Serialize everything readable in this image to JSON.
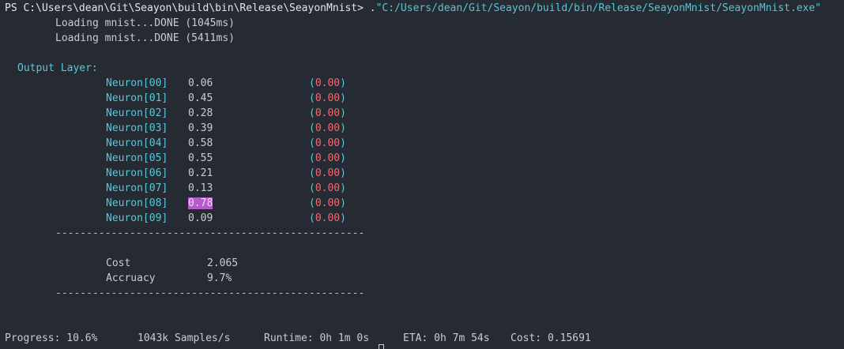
{
  "prompt": {
    "prefix": "PS C:\\Users\\dean\\Git\\Seayon\\build\\bin\\Release\\SeayonMnist> ",
    "command_dot": ".",
    "command_path": "\"C:/Users/dean/Git/Seayon/build/bin/Release/SeayonMnist/SeayonMnist.exe\""
  },
  "loading": [
    "Loading mnist...DONE (1045ms)",
    "Loading mnist...DONE (5411ms)"
  ],
  "output_layer": {
    "heading": "Output Layer:",
    "neurons": [
      {
        "label": "Neuron[00]",
        "value": "0.06",
        "open": "(",
        "target": "0.00",
        "close": ")"
      },
      {
        "label": "Neuron[01]",
        "value": "0.45",
        "open": "(",
        "target": "0.00",
        "close": ")"
      },
      {
        "label": "Neuron[02]",
        "value": "0.28",
        "open": "(",
        "target": "0.00",
        "close": ")"
      },
      {
        "label": "Neuron[03]",
        "value": "0.39",
        "open": "(",
        "target": "0.00",
        "close": ")"
      },
      {
        "label": "Neuron[04]",
        "value": "0.58",
        "open": "(",
        "target": "0.00",
        "close": ")"
      },
      {
        "label": "Neuron[05]",
        "value": "0.55",
        "open": "(",
        "target": "0.00",
        "close": ")"
      },
      {
        "label": "Neuron[06]",
        "value": "0.21",
        "open": "(",
        "target": "0.00",
        "close": ")"
      },
      {
        "label": "Neuron[07]",
        "value": "0.13",
        "open": "(",
        "target": "0.00",
        "close": ")"
      },
      {
        "label": "Neuron[08]",
        "value": "0.78",
        "open": "(",
        "target": "0.00",
        "close": ")"
      },
      {
        "label": "Neuron[09]",
        "value": "0.09",
        "open": "(",
        "target": "0.00",
        "close": ")"
      }
    ],
    "highlighted_index": 8
  },
  "divider": "--------------------------------------------------",
  "stats": {
    "cost_label": "Cost",
    "cost_value": "2.065",
    "accuracy_label": "Accruacy",
    "accuracy_value": "9.7%"
  },
  "status_bar": {
    "progress": "Progress: 10.6%",
    "samples": "1043k Samples/s",
    "runtime": "Runtime: 0h 1m 0s",
    "eta": "ETA: 0h 7m 54s",
    "cost": "Cost: 0.15691"
  },
  "colors": {
    "background": "#262a33",
    "cyan": "#5ac8d8",
    "red": "#ef6b73",
    "highlight": "#b45cc8"
  }
}
